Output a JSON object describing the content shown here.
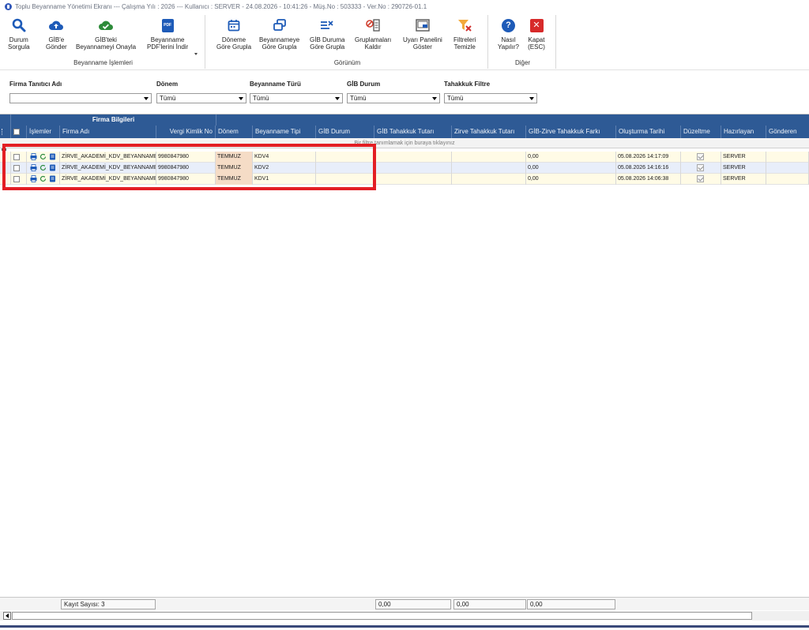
{
  "window": {
    "title": "Toplu Beyanname Yönetimi Ekranı  ---  Çalışma Yılı : 2026  ---  Kullanıcı : SERVER - 24.08.2026 - 10:41:26 - Müş.No : 503333 - Ver.No : 290726-01.1"
  },
  "ribbon": {
    "groups": [
      {
        "label": "Beyanname İşlemleri"
      },
      {
        "label": "Görünüm"
      },
      {
        "label": "Diğer"
      }
    ],
    "buttons": {
      "durum_sorgula": [
        "Durum",
        "Sorgula"
      ],
      "gibe_gonder": [
        "GİB'e",
        "Gönder"
      ],
      "onayla": [
        "GİB'teki",
        "Beyannameyi Onayla"
      ],
      "pdf_indir": [
        "Beyanname",
        "PDF'lerini İndir"
      ],
      "doneme_gore": [
        "Döneme",
        "Göre Grupla"
      ],
      "beyannameye_gore": [
        "Beyannameye",
        "Göre Grupla"
      ],
      "gib_durumu_gore": [
        "GİB Duruma",
        "Göre Grupla"
      ],
      "gruplamalari_kaldir": [
        "Gruplamaları",
        "Kaldır"
      ],
      "uyari_paneli": [
        "Uyarı Panelini",
        "Göster"
      ],
      "filtreleri_temizle": [
        "Filtreleri",
        "Temizle"
      ],
      "nasil_yapilir": [
        "Nasıl",
        "Yapılır?"
      ],
      "kapat": [
        "Kapat",
        "(ESC)"
      ]
    },
    "pdf_badge": "PDF"
  },
  "filters": {
    "firma": {
      "label": "Firma Tanıtıcı Adı",
      "value": ""
    },
    "donem": {
      "label": "Dönem",
      "value": "Tümü"
    },
    "beyanname_turu": {
      "label": "Beyanname Türü",
      "value": "Tümü"
    },
    "gib_durum": {
      "label": "GİB Durum",
      "value": "Tümü"
    },
    "tahakkuk": {
      "label": "Tahakkuk Filtre",
      "value": "Tümü"
    }
  },
  "grid": {
    "band_title": "Firma Bilgileri",
    "columns": [
      "İşlemler",
      "Firma Adı",
      "Vergi Kimlik No",
      "Dönem",
      "Beyanname Tipi",
      "GİB Durum",
      "GİB Tahakkuk Tutarı",
      "Zirve Tahakkuk Tutarı",
      "GİB-Zirve Tahakkuk Farkı",
      "Oluşturma Tarihi",
      "Düzeltme",
      "Hazırlayan",
      "Gönderen"
    ],
    "filter_hint": "Bir filtre tanımlamak için buraya tıklayınız",
    "rows": [
      {
        "firma": "ZİRVE_AKADEMİ_KDV_BEYANNAME",
        "vkn": "9980847980",
        "donem": "TEMMUZ",
        "tip": "KDV4",
        "gib_durum": "",
        "gib_tutar": "",
        "zirve_tutar": "",
        "fark": "0,00",
        "tarih": "05.08.2026 14:17:09",
        "duzeltme": true,
        "hazirlayan": "SERVER",
        "gonderen": ""
      },
      {
        "firma": "ZİRVE_AKADEMİ_KDV_BEYANNAME",
        "vkn": "9980847980",
        "donem": "TEMMUZ",
        "tip": "KDV2",
        "gib_durum": "",
        "gib_tutar": "",
        "zirve_tutar": "",
        "fark": "0,00",
        "tarih": "05.08.2026 14:16:16",
        "duzeltme": true,
        "hazirlayan": "SERVER",
        "gonderen": ""
      },
      {
        "firma": "ZİRVE_AKADEMİ_KDV_BEYANNAME",
        "vkn": "9980847980",
        "donem": "TEMMUZ",
        "tip": "KDV1",
        "gib_durum": "",
        "gib_tutar": "",
        "zirve_tutar": "",
        "fark": "0,00",
        "tarih": "05.08.2026 14:06:38",
        "duzeltme": true,
        "hazirlayan": "SERVER",
        "gonderen": ""
      }
    ]
  },
  "footer": {
    "kayit_sayisi": "Kayıt Sayısı: 3",
    "sum_gib": "0,00",
    "sum_zirve": "0,00",
    "sum_fark": "0,00"
  },
  "colors": {
    "header_bg": "#2e5a95",
    "highlight": "#e31e24",
    "row_even": "#fffbe6",
    "row_odd": "#e8eefa"
  }
}
